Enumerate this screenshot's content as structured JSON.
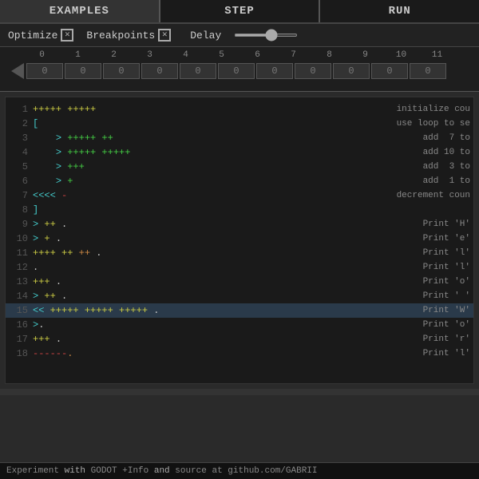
{
  "nav": {
    "items": [
      "EXAMPLES",
      "STEP",
      "RUN"
    ]
  },
  "controls": {
    "optimize_label": "Optimize",
    "optimize_checked": true,
    "breakpoints_label": "Breakpoints",
    "breakpoints_checked": true,
    "delay_label": "Delay",
    "slider_value": 60
  },
  "ruler": {
    "numbers": [
      "0",
      "1",
      "2",
      "3",
      "4",
      "5",
      "6",
      "7",
      "8",
      "9",
      "10",
      "11"
    ],
    "cells": [
      "0",
      "0",
      "0",
      "0",
      "0",
      "0",
      "0",
      "0",
      "0",
      "0",
      "0",
      "0"
    ]
  },
  "code": {
    "lines": [
      {
        "num": "1",
        "left": "+++++ +++++",
        "left_colors": "yellow",
        "right": "initialize cou",
        "highlighted": false
      },
      {
        "num": "2",
        "left": "[",
        "left_colors": "cyan",
        "right": "use loop to se",
        "highlighted": false
      },
      {
        "num": "3",
        "left": "  > +++++ ++",
        "left_colors": "green",
        "right": "  add  7 to",
        "highlighted": false
      },
      {
        "num": "4",
        "left": "  > +++++ +++++",
        "left_colors": "green",
        "right": "  add 10 to",
        "highlighted": false
      },
      {
        "num": "5",
        "left": "  > +++",
        "left_colors": "green",
        "right": "  add  3 to",
        "highlighted": false
      },
      {
        "num": "6",
        "left": "  > +",
        "left_colors": "green",
        "right": "  add  1 to",
        "highlighted": false
      },
      {
        "num": "7",
        "left": "<<<< -",
        "left_colors": "cyan",
        "right": "decrement coun",
        "highlighted": false
      },
      {
        "num": "8",
        "left": "]",
        "left_colors": "cyan",
        "right": "",
        "highlighted": false
      },
      {
        "num": "9",
        "left": "> ++ .",
        "left_colors": "green",
        "right": "Print 'H'",
        "highlighted": false
      },
      {
        "num": "10",
        "left": "> + .",
        "left_colors": "green",
        "right": "Print 'e'",
        "highlighted": false
      },
      {
        "num": "11",
        "left": "++++ ++ .",
        "left_colors": "yellow",
        "right": "Print 'l'",
        "highlighted": false
      },
      {
        "num": "12",
        "left": ".",
        "left_colors": "white",
        "right": "Print 'l'",
        "highlighted": false
      },
      {
        "num": "13",
        "left": "+++ .",
        "left_colors": "yellow",
        "right": "Print 'o'",
        "highlighted": false
      },
      {
        "num": "14",
        "left": "> ++ .",
        "left_colors": "green",
        "right": "Print ' '",
        "highlighted": false
      },
      {
        "num": "15",
        "left": "<< +++++ +++++ +++++ .",
        "left_colors": "cyan",
        "right": "Print 'W'",
        "highlighted": true
      },
      {
        "num": "16",
        "left": ">.",
        "left_colors": "green",
        "right": "Print 'o'",
        "highlighted": false
      },
      {
        "num": "17",
        "left": "+++ .",
        "left_colors": "yellow",
        "right": "Print 'r'",
        "highlighted": false
      },
      {
        "num": "18",
        "left": "------.",
        "left_colors": "red",
        "right": "Print 'l'",
        "highlighted": false
      }
    ]
  },
  "status": {
    "text": "Experiment with GODOT +Info and source at github.com/GABRII",
    "with": "with",
    "and": "and"
  }
}
